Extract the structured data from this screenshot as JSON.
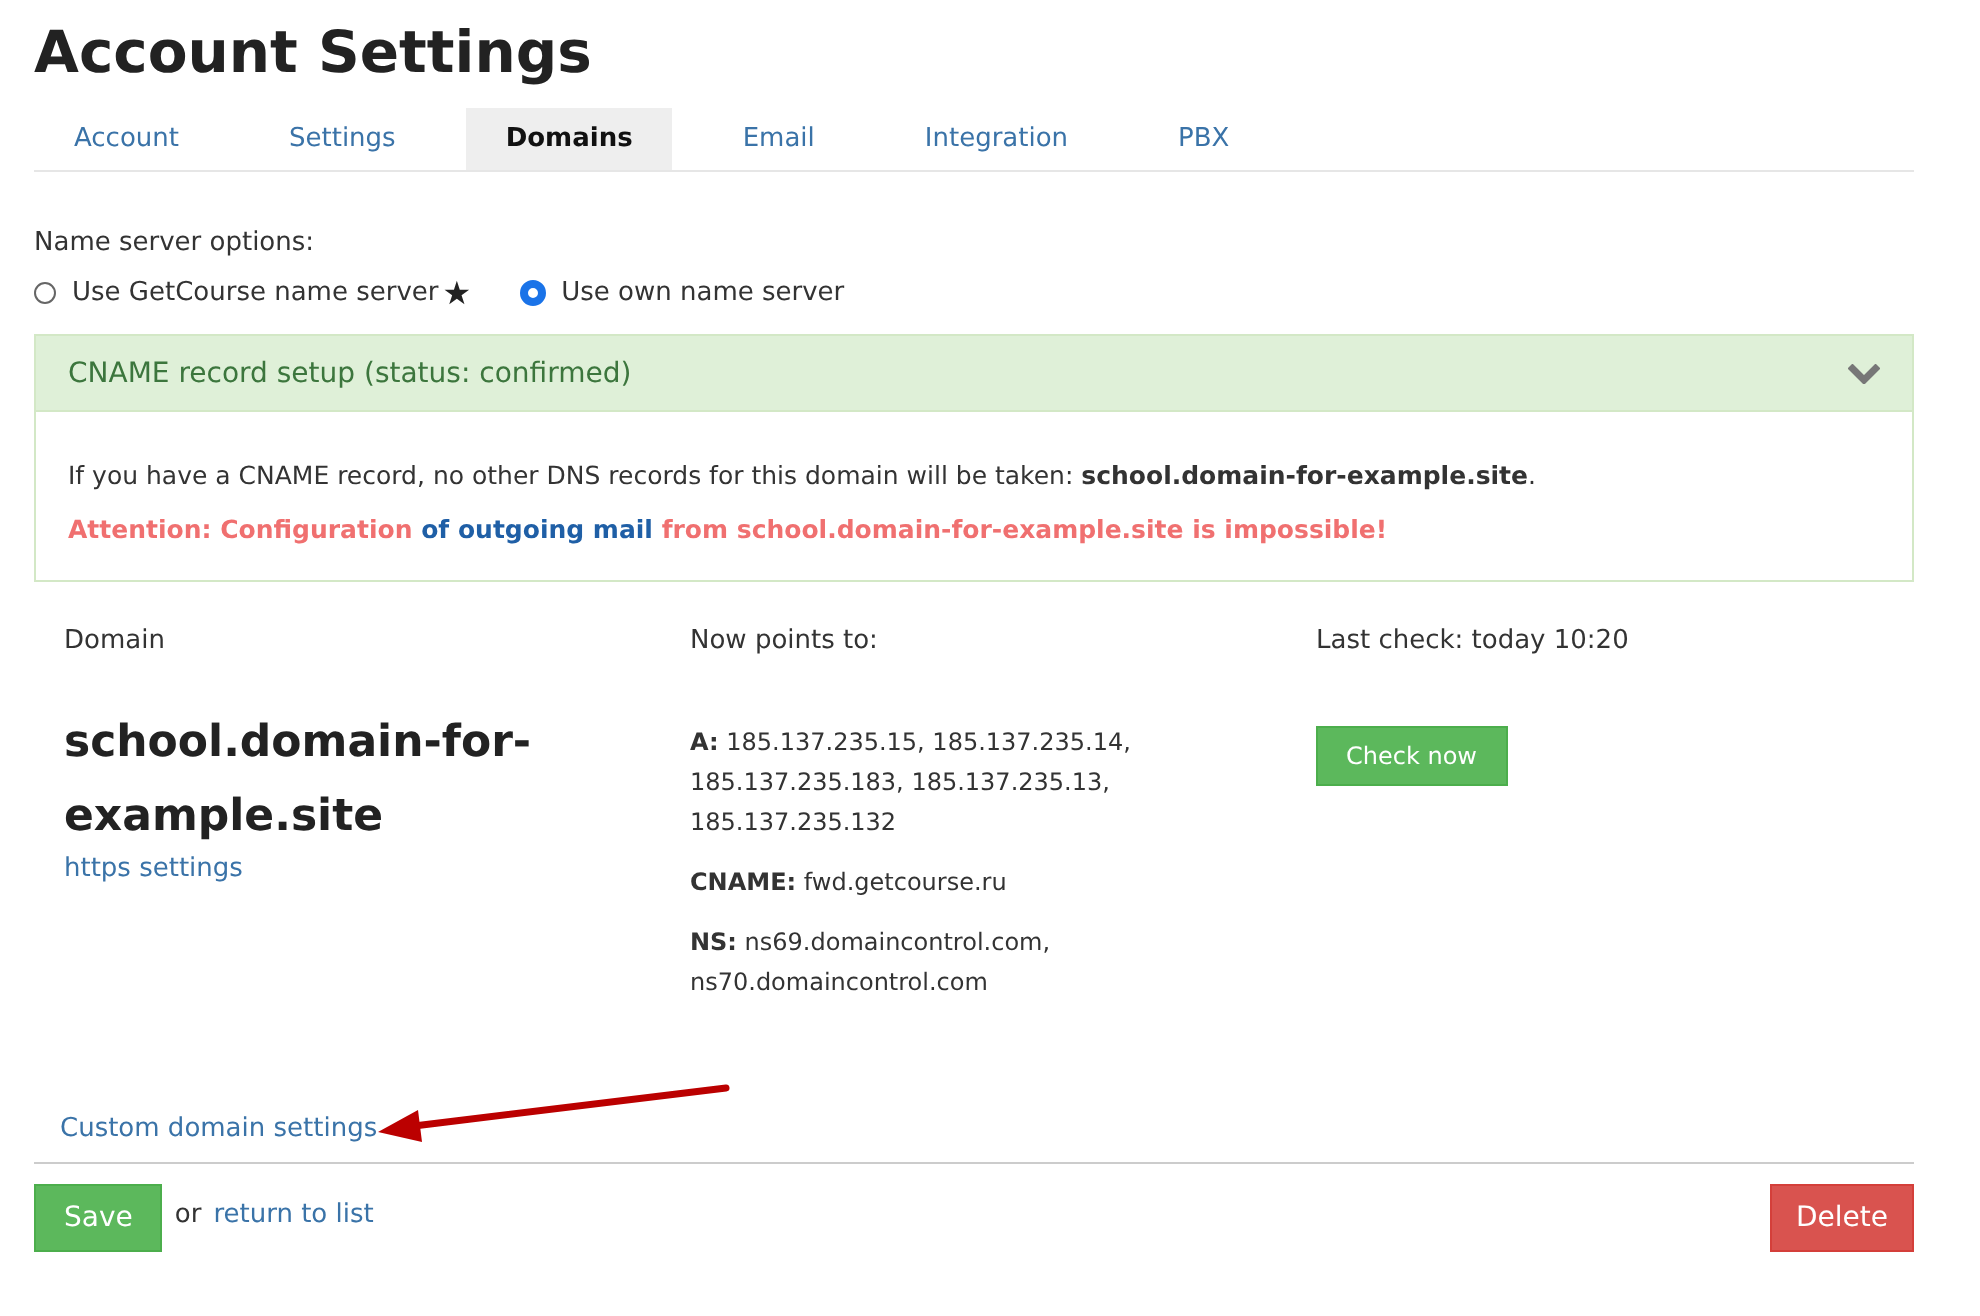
{
  "page": {
    "title": "Account Settings"
  },
  "tabs": [
    {
      "label": "Account",
      "selected": false
    },
    {
      "label": "Settings",
      "selected": false
    },
    {
      "label": "Domains",
      "selected": true
    },
    {
      "label": "Email",
      "selected": false
    },
    {
      "label": "Integration",
      "selected": false
    },
    {
      "label": "PBX",
      "selected": false
    }
  ],
  "name_server": {
    "label": "Name server options:",
    "options": [
      {
        "label": "Use GetCourse name server",
        "star": "★",
        "selected": false
      },
      {
        "label": "Use own name server",
        "selected": true
      }
    ]
  },
  "cname_panel": {
    "title": "CNAME record setup (status: confirmed)",
    "expanded": true,
    "info": "If you have a CNAME record, no other DNS records for this domain will be taken: **school.domain-for-example.site**.",
    "warning_before": "Attention: Configuration",
    "warning_link": "of outgoing mail",
    "warning_after": "from school.domain-for-example.site is impossible!"
  },
  "domain": {
    "column_label": "Domain",
    "name": "school.domain-for-example.site",
    "https_link": "https settings"
  },
  "points_to": {
    "column_label": "Now points to:",
    "records": [
      {
        "type": "A:",
        "value": "185.137.235.15, 185.137.235.14, 185.137.235.183, 185.137.235.13, 185.137.235.132"
      },
      {
        "type": "CNAME:",
        "value": "fwd.getcourse.ru"
      },
      {
        "type": "NS:",
        "value": "ns69.domaincontrol.com, ns70.domaincontrol.com"
      }
    ]
  },
  "check": {
    "last_check": "Last check: today 10:20",
    "button": "Check now"
  },
  "custom_link": "Custom domain settings",
  "footer": {
    "save": "Save",
    "or": "or",
    "return_link": "return to list",
    "delete": "Delete"
  }
}
